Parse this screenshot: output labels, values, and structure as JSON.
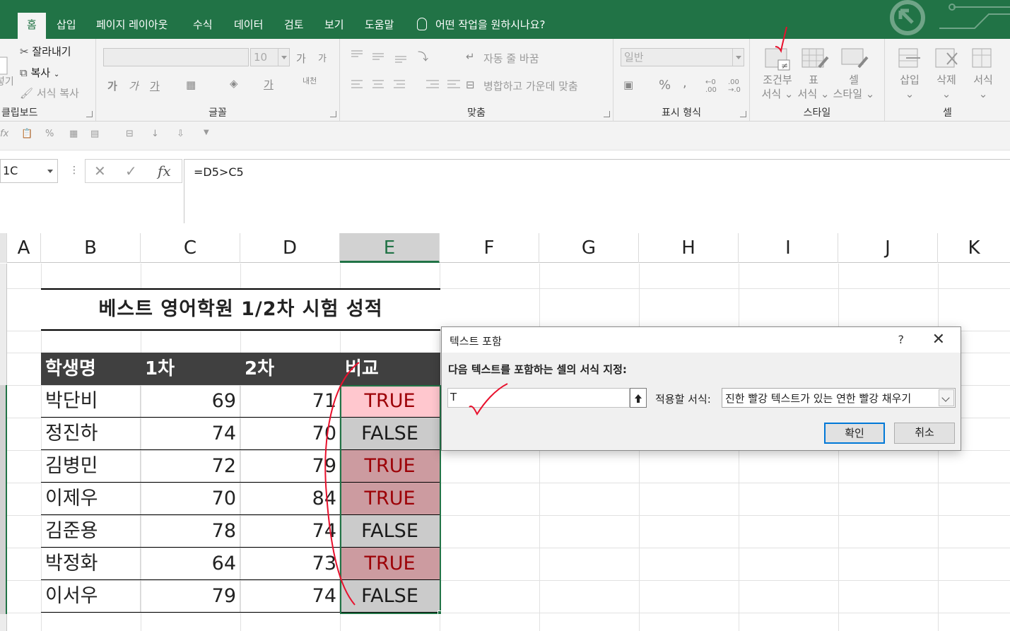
{
  "tabs": [
    "홈",
    "삽입",
    "페이지 레이아웃",
    "수식",
    "데이터",
    "검토",
    "보기",
    "도움말"
  ],
  "tell_me": "어떤 작업을 원하시나요?",
  "ribbon": {
    "clipboard": {
      "cut": "잘라내기",
      "copy": "복사",
      "format_painter": "서식 복사",
      "paste_partial": "넣기",
      "label": "클립보드"
    },
    "font": {
      "name": "",
      "size": "10",
      "grow": "가",
      "shrink": "가",
      "bold": "가",
      "italic": "가",
      "underline": "가",
      "font_color": "가",
      "phonetic": "내천",
      "label": "글꼴"
    },
    "align": {
      "wrap": "자동 줄 바꿈",
      "merge": "병합하고 가운데 맞춤",
      "label": "맞춤"
    },
    "number": {
      "format": "일반",
      "percent": "%",
      "comma": ",",
      "label": "표시 형식"
    },
    "styles": {
      "conditional_l1": "조건부",
      "conditional_l2": "서식",
      "table_l1": "표",
      "table_l2": "서식",
      "cell_l1": "셀",
      "cell_l2": "스타일",
      "label": "스타일"
    },
    "cells": {
      "insert": "삽입",
      "delete": "삭제",
      "format": "서식",
      "label": "셀"
    }
  },
  "formula_bar": {
    "name_box": "1C",
    "formula": "=D5>C5"
  },
  "columns": [
    "A",
    "B",
    "C",
    "D",
    "E",
    "F",
    "G",
    "H",
    "I",
    "J",
    "K"
  ],
  "sheet": {
    "title": "베스트 영어학원 1/2차 시험 성적",
    "headers": [
      "학생명",
      "1차",
      "2차",
      "비교"
    ],
    "rows": [
      {
        "name": "박단비",
        "c": "69",
        "d": "71",
        "e": "TRUE"
      },
      {
        "name": "정진하",
        "c": "74",
        "d": "70",
        "e": "FALSE"
      },
      {
        "name": "김병민",
        "c": "72",
        "d": "79",
        "e": "TRUE"
      },
      {
        "name": "이제우",
        "c": "70",
        "d": "84",
        "e": "TRUE"
      },
      {
        "name": "김준용",
        "c": "78",
        "d": "74",
        "e": "FALSE"
      },
      {
        "name": "박정화",
        "c": "64",
        "d": "73",
        "e": "TRUE"
      },
      {
        "name": "이서우",
        "c": "79",
        "d": "74",
        "e": "FALSE"
      }
    ]
  },
  "dialog": {
    "title": "텍스트 포함",
    "help": "?",
    "close": "✕",
    "prompt": "다음 텍스트를 포함하는 셀의 서식 지정:",
    "input_value": "T",
    "format_label": "적용할 서식:",
    "format_value": "진한 빨강 텍스트가 있는 연한 빨강 채우기",
    "ok": "확인",
    "cancel": "취소"
  },
  "colors": {
    "excel_green": "#217346",
    "light_red_fill": "#ffc7ce",
    "dark_red_text": "#9c0006",
    "annotation_red": "#e8112d"
  }
}
